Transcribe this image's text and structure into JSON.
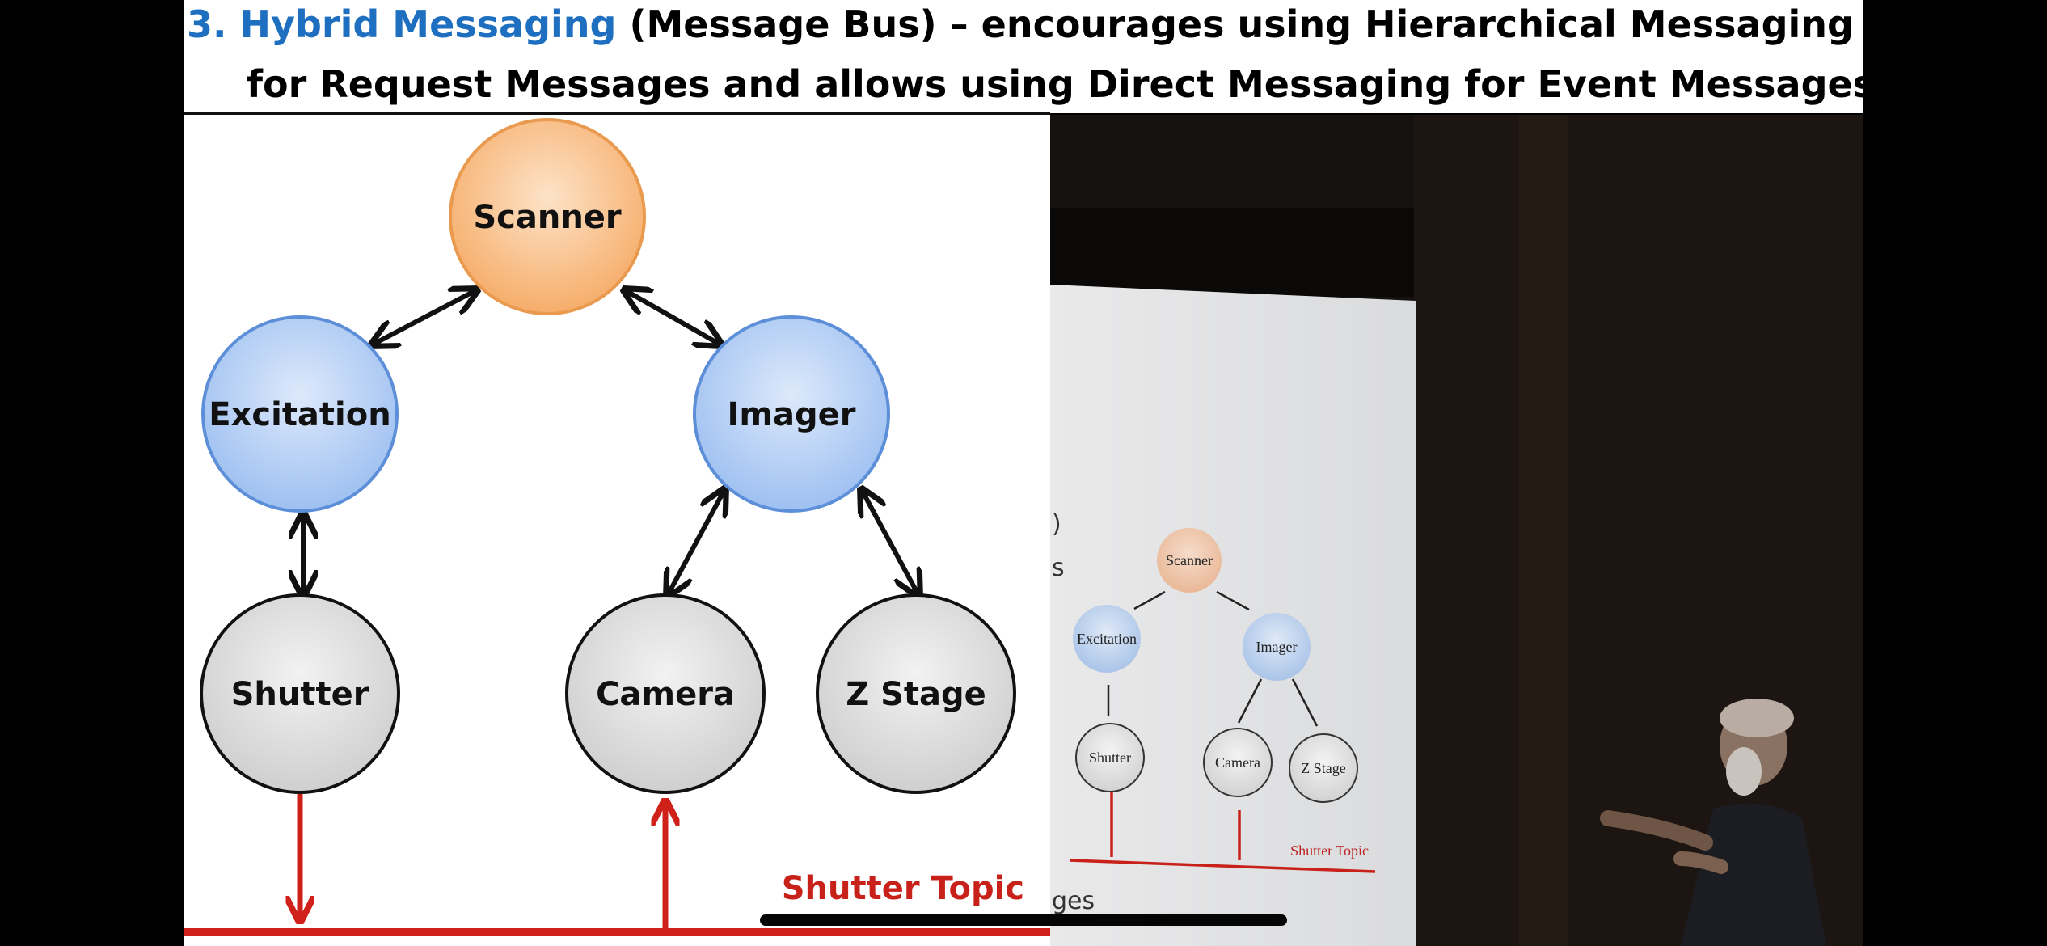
{
  "title": {
    "number": "3.",
    "highlight": "Hybrid Messaging",
    "line1_rest": "(Message Bus) – encourages using Hierarchical Messaging",
    "line2": "for Request Messages and allows using Direct Messaging for Event Messages"
  },
  "diagram": {
    "nodes": {
      "scanner": "Scanner",
      "excitation": "Excitation",
      "imager": "Imager",
      "shutter": "Shutter",
      "camera": "Camera",
      "zstage": "Z Stage"
    },
    "topic_label": "Shutter Topic"
  },
  "video": {
    "screen_fragment_1": ")",
    "screen_fragment_2": "s",
    "screen_fragment_3": "ges",
    "mini_nodes": {
      "scanner": "Scanner",
      "excitation": "Excitation",
      "imager": "Imager",
      "shutter": "Shutter",
      "camera": "Camera",
      "zstage": "Z Stage"
    },
    "mini_topic_label": "Shutter Topic"
  },
  "colors": {
    "title_blue": "#1f6fc0",
    "topic_red": "#c8211a",
    "scanner_orange": "#f7b97a",
    "blue_node": "#a9c8f3",
    "gray_node": "#d9d9d9"
  }
}
